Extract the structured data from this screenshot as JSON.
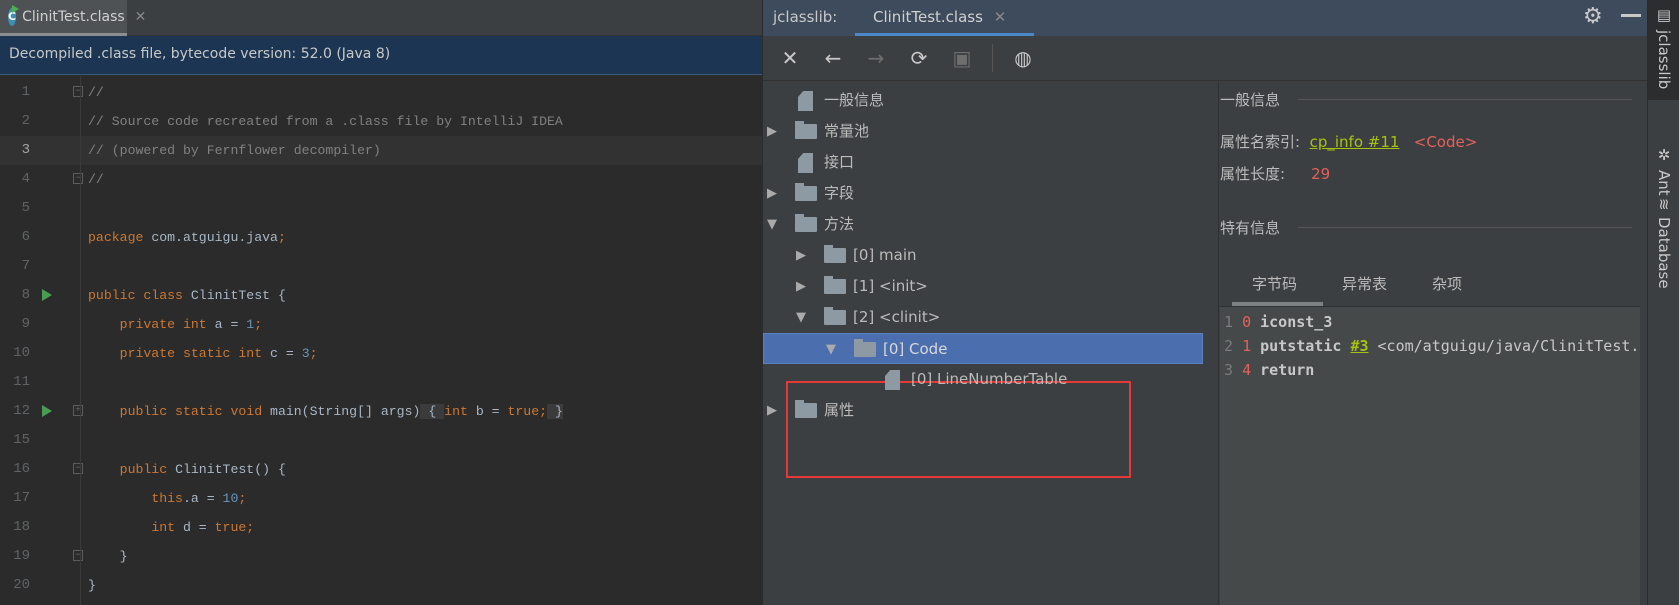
{
  "editor": {
    "tab_label": "ClinitTest.class",
    "tab_icon": "java-class-icon",
    "banner": "Decompiled .class file, bytecode version: 52.0 (Java 8)",
    "current_line": 3,
    "lines": [
      {
        "n": "1",
        "segs": [
          [
            "cm",
            "//"
          ]
        ],
        "fold": "-"
      },
      {
        "n": "2",
        "segs": [
          [
            "cm",
            "// Source code recreated from a .class file by IntelliJ IDEA"
          ]
        ]
      },
      {
        "n": "3",
        "segs": [
          [
            "cm",
            "// (powered by Fernflower decompiler)"
          ]
        ]
      },
      {
        "n": "4",
        "segs": [
          [
            "cm",
            "//"
          ]
        ],
        "fold": "-"
      },
      {
        "n": "5",
        "segs": []
      },
      {
        "n": "6",
        "segs": [
          [
            "kw",
            "package "
          ],
          [
            "",
            "com.atguigu.java"
          ],
          [
            "kw",
            ";"
          ]
        ]
      },
      {
        "n": "7",
        "segs": []
      },
      {
        "n": "8",
        "segs": [
          [
            "kw",
            "public class "
          ],
          [
            "",
            "ClinitTest {"
          ]
        ],
        "run": true
      },
      {
        "n": "9",
        "segs": [
          [
            "",
            "    "
          ],
          [
            "kw",
            "private int "
          ],
          [
            "",
            "a = "
          ],
          [
            "num",
            "1"
          ],
          [
            "kw",
            ";"
          ]
        ]
      },
      {
        "n": "10",
        "segs": [
          [
            "",
            "    "
          ],
          [
            "kw",
            "private static int "
          ],
          [
            "",
            "c = "
          ],
          [
            "num",
            "3"
          ],
          [
            "kw",
            ";"
          ]
        ]
      },
      {
        "n": "11",
        "segs": []
      },
      {
        "n": "12",
        "segs": [
          [
            "",
            "    "
          ],
          [
            "kw",
            "public static void "
          ],
          [
            "",
            "main(String[] args)"
          ],
          [
            "fb",
            " { "
          ],
          [
            "kw",
            "int "
          ],
          [
            "",
            "b = "
          ],
          [
            "kw",
            "true;"
          ],
          [
            "fb",
            " }"
          ]
        ],
        "run": true,
        "fold": "+"
      },
      {
        "n": "15",
        "segs": []
      },
      {
        "n": "16",
        "segs": [
          [
            "",
            "    "
          ],
          [
            "kw",
            "public "
          ],
          [
            "",
            "ClinitTest() {"
          ]
        ],
        "fold": "-"
      },
      {
        "n": "17",
        "segs": [
          [
            "",
            "        "
          ],
          [
            "kw",
            "this"
          ],
          [
            "",
            ".a = "
          ],
          [
            "num",
            "10"
          ],
          [
            "kw",
            ";"
          ]
        ]
      },
      {
        "n": "18",
        "segs": [
          [
            "",
            "        "
          ],
          [
            "kw",
            "int "
          ],
          [
            "",
            "d = "
          ],
          [
            "kw",
            "true;"
          ]
        ]
      },
      {
        "n": "19",
        "segs": [
          [
            "",
            "    }"
          ]
        ],
        "fold": "-"
      },
      {
        "n": "20",
        "segs": [
          [
            "",
            "}"
          ]
        ]
      }
    ]
  },
  "jclasslib": {
    "title": "jclasslib:",
    "tab_label": "ClinitTest.class",
    "toolbar": [
      {
        "name": "close-icon",
        "glyph": "✕",
        "enabled": true
      },
      {
        "name": "back-icon",
        "glyph": "←",
        "enabled": true
      },
      {
        "name": "forward-icon",
        "glyph": "→",
        "enabled": false
      },
      {
        "name": "refresh-icon",
        "glyph": "⟳",
        "enabled": true
      },
      {
        "name": "save-icon",
        "glyph": "▣",
        "enabled": false
      },
      {
        "name": "web-icon",
        "glyph": "◍",
        "enabled": true
      }
    ],
    "tree": [
      {
        "label": "一般信息",
        "depth": 0,
        "type": "file",
        "arrow": ""
      },
      {
        "label": "常量池",
        "depth": 0,
        "type": "folder",
        "arrow": "▶"
      },
      {
        "label": "接口",
        "depth": 0,
        "type": "file",
        "arrow": ""
      },
      {
        "label": "字段",
        "depth": 0,
        "type": "folder",
        "arrow": "▶"
      },
      {
        "label": "方法",
        "depth": 0,
        "type": "folder",
        "arrow": "▼"
      },
      {
        "label": "[0] main",
        "depth": 1,
        "type": "folder",
        "arrow": "▶"
      },
      {
        "label": "[1] <init>",
        "depth": 1,
        "type": "folder",
        "arrow": "▶"
      },
      {
        "label": "[2] <clinit>",
        "depth": 1,
        "type": "folder",
        "arrow": "▼"
      },
      {
        "label": "[0] Code",
        "depth": 2,
        "type": "folder",
        "arrow": "▼",
        "selected": true
      },
      {
        "label": "[0] LineNumberTable",
        "depth": 3,
        "type": "file",
        "arrow": ""
      },
      {
        "label": "属性",
        "depth": 0,
        "type": "folder",
        "arrow": "▶"
      }
    ],
    "highlight_color": "#e53935",
    "detail": {
      "general_title": "一般信息",
      "attr_name_label": "属性名索引:",
      "attr_name_link": "cp_info #11",
      "attr_name_value": "<Code>",
      "attr_len_label": "属性长度:",
      "attr_len_value": "29",
      "specific_title": "特有信息",
      "tabs": [
        "字节码",
        "异常表",
        "杂项"
      ],
      "active_tab": "字节码",
      "bytecode": [
        {
          "line": "1",
          "offset": "0",
          "op": "iconst_3",
          "ref": "",
          "arg": ""
        },
        {
          "line": "2",
          "offset": "1",
          "op": "putstatic",
          "ref": "#3",
          "arg": "<com/atguigu/java/ClinitTest.c>"
        },
        {
          "line": "3",
          "offset": "4",
          "op": "return",
          "ref": "",
          "arg": ""
        }
      ]
    }
  },
  "right_stripe": [
    {
      "label": "jclasslib",
      "icon": "jclasslib-icon",
      "active": true
    },
    {
      "label": "Ant",
      "icon": "ant-icon"
    },
    {
      "label": "Database",
      "icon": "database-icon"
    }
  ]
}
